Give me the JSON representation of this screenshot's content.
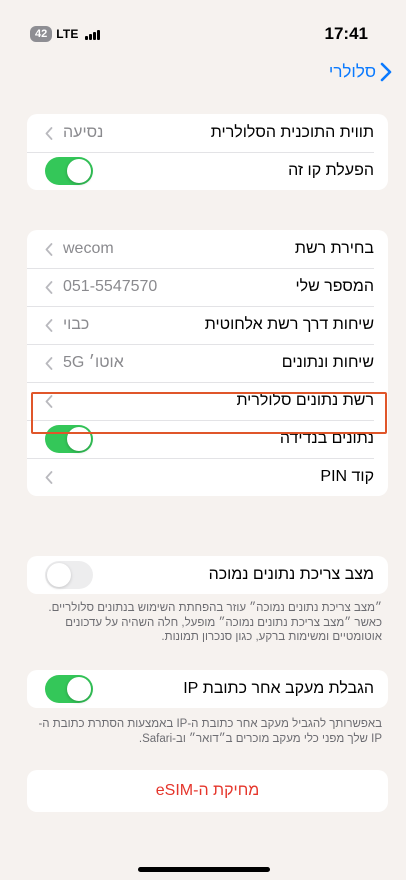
{
  "status_bar": {
    "battery": "42",
    "network": "LTE",
    "time": "17:41"
  },
  "nav": {
    "back_label": "סלולרי"
  },
  "group1": [
    {
      "label": "תווית התוכנית הסלולרית",
      "value": "נסיעה",
      "type": "disclosure"
    },
    {
      "label": "הפעלת קו זה",
      "type": "toggle",
      "state": "on"
    }
  ],
  "group2": [
    {
      "label": "בחירת רשת",
      "value": "wecom",
      "type": "disclosure"
    },
    {
      "label": "המספר שלי",
      "value": "051-5547570",
      "type": "disclosure"
    },
    {
      "label": "שיחות דרך רשת אלחוטית",
      "value": "כבוי",
      "type": "disclosure"
    },
    {
      "label": "שיחות ונתונים",
      "value": "אוטו׳ 5G",
      "type": "disclosure"
    },
    {
      "label": "רשת נתונים סלולרית",
      "value": "",
      "type": "disclosure"
    },
    {
      "label": "נתונים בנדידה",
      "type": "toggle",
      "state": "on"
    },
    {
      "label": "קוד PIN",
      "value": "",
      "type": "disclosure"
    }
  ],
  "low_data": {
    "label": "מצב צריכת נתונים נמוכה",
    "state": "off-disabled",
    "footnote": "״מצב צריכת נתונים נמוכה״ עוזר בהפחתת השימוש בנתונים סלולריים. כאשר ״מצב צריכת נתונים נמוכה״ מופעל, חלה השהיה על עדכונים אוטומטיים ומשימות ברקע, כגון סנכרון תמונות."
  },
  "ip_tracking": {
    "label": "הגבלת מעקב אחר כתובת IP",
    "state": "on",
    "footnote": "באפשרותך להגביל מעקב אחר כתובת ה-IP באמצעות הסתרת כתובת ה-IP שלך מפני כלי מעקב מוכרים ב״דואר״ וב-Safari."
  },
  "esim_button": {
    "label": "מחיקת ה-eSIM"
  },
  "colors": {
    "accent": "#0a7aff",
    "toggle_on": "#34c759",
    "destructive": "#e5352b",
    "highlight": "#e0562a"
  }
}
